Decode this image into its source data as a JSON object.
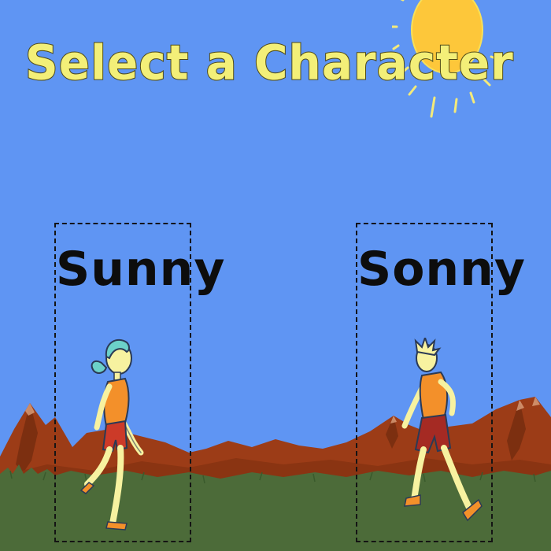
{
  "title": "Select a Character",
  "characters": [
    {
      "name": "Sunny"
    },
    {
      "name": "Sonny"
    }
  ],
  "colors": {
    "sky": "#5f95f3",
    "title_text": "#f3ef78",
    "sun": "#fdc73a",
    "mountains": "#9c3c17",
    "grass": "#4c6b39"
  }
}
